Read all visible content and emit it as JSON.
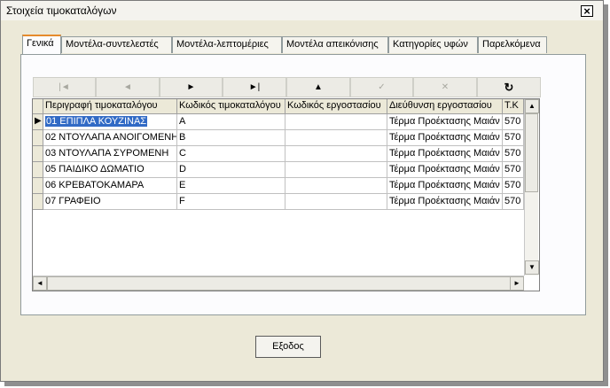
{
  "window": {
    "title": "Στοιχεία τιμοκαταλόγων",
    "close_label": "×"
  },
  "tabs": [
    {
      "label": "Γενικά",
      "active": true
    },
    {
      "label": "Μοντέλα-συντελεστές",
      "active": false
    },
    {
      "label": "Μοντέλα-λεπτομέριες",
      "active": false
    },
    {
      "label": "Μοντέλα απεικόνισης",
      "active": false
    },
    {
      "label": "Κατηγορίες υφών",
      "active": false
    },
    {
      "label": "Παρελκόμενα",
      "active": false
    }
  ],
  "navigator": [
    {
      "name": "first-record-button",
      "glyph": "|◄",
      "enabled": false
    },
    {
      "name": "prior-record-button",
      "glyph": "◄",
      "enabled": false
    },
    {
      "name": "next-record-button",
      "glyph": "►",
      "enabled": true
    },
    {
      "name": "last-record-button",
      "glyph": "►|",
      "enabled": true
    },
    {
      "name": "insert-record-button",
      "glyph": "▲",
      "enabled": true
    },
    {
      "name": "post-record-button",
      "glyph": "✓",
      "enabled": false
    },
    {
      "name": "cancel-record-button",
      "glyph": "✕",
      "enabled": false
    },
    {
      "name": "refresh-button",
      "glyph": "↻",
      "enabled": true
    }
  ],
  "grid": {
    "columns": [
      "Περιγραφή τιμοκαταλόγου",
      "Κωδικός τιμοκαταλόγου",
      "Κωδικός εργοστασίου",
      "Διεύθυνση εργοστασίου",
      "T.K"
    ],
    "rows": [
      [
        "01 ΕΠΙΠΛΑ ΚΟΥΖΙΝΑΣ",
        "A",
        "",
        "Τέρμα Προέκτασης Μαιάν",
        "570"
      ],
      [
        "02 ΝΤΟΥΛΑΠΑ ΑΝΟΙΓΟΜΕΝΗ",
        "B",
        "",
        "Τέρμα Προέκτασης Μαιάν",
        "570"
      ],
      [
        "03 ΝΤΟΥΛΑΠΑ ΣΥΡΟΜΕΝΗ",
        "C",
        "",
        "Τέρμα Προέκτασης Μαιάν",
        "570"
      ],
      [
        "05 ΠΑΙΔΙΚΟ ΔΩΜΑΤΙΟ",
        "D",
        "",
        "Τέρμα Προέκτασης Μαιάν",
        "570"
      ],
      [
        "06 ΚΡΕΒΑΤΟΚΑΜΑΡΑ",
        "E",
        "",
        "Τέρμα Προέκτασης Μαιάν",
        "570"
      ],
      [
        "07 ΓΡΑΦΕΙΟ",
        "F",
        "",
        "Τέρμα Προέκτασης Μαιάν",
        "570"
      ]
    ],
    "selected_row": 0
  },
  "footer": {
    "exit_label": "Εξοδος"
  }
}
